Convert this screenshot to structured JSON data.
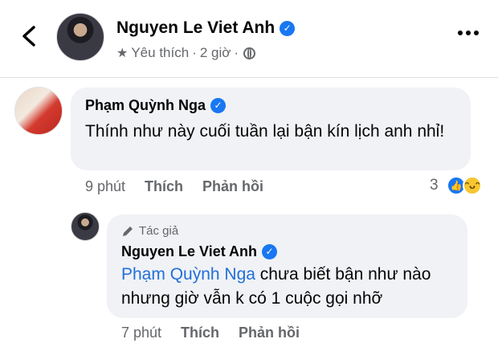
{
  "header": {
    "author": "Nguyen Le Viet Anh",
    "meta_label": "Yêu thích",
    "meta_time": "2 giờ"
  },
  "comment": {
    "author": "Phạm Quỳnh Nga",
    "text": "Thính như này cuối tuần lại bận kín lịch anh nhỉ!",
    "time": "9 phút",
    "like_label": "Thích",
    "reply_label": "Phản hồi",
    "reaction_count": "3",
    "reaction_icons": [
      "like-icon",
      "haha-icon"
    ]
  },
  "reply": {
    "author_tag": "Tác giả",
    "author": "Nguyen Le Viet Anh",
    "mention": "Phạm Quỳnh Nga",
    "text": "chưa biết bận như nào nhưng giờ vẫn k có 1 cuộc gọi nhỡ",
    "time": "7 phút",
    "like_label": "Thích",
    "reply_label": "Phản hồi"
  },
  "colors": {
    "verified": "#1877f2",
    "bubble": "#f0f2f5",
    "secondary_text": "#65676b",
    "mention": "#216fdb"
  }
}
